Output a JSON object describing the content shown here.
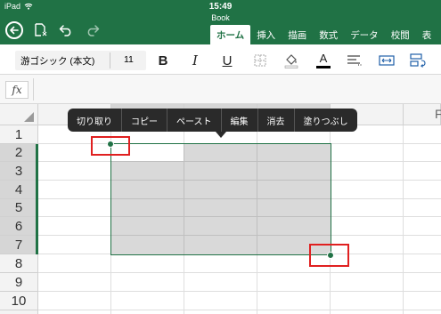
{
  "status": {
    "device": "iPad",
    "time": "15:49"
  },
  "document": {
    "title": "Book"
  },
  "tabs": [
    {
      "label": "ホーム",
      "active": true
    },
    {
      "label": "挿入"
    },
    {
      "label": "描画"
    },
    {
      "label": "数式"
    },
    {
      "label": "データ"
    },
    {
      "label": "校閲"
    },
    {
      "label": "表"
    }
  ],
  "ribbon": {
    "font_name": "游ゴシック (本文)",
    "font_size": "11",
    "bold": "B",
    "italic": "I",
    "underline": "U",
    "font_color_letter": "A",
    "font_color": "#000000"
  },
  "formula_bar": {
    "fx_label": "fx",
    "value": ""
  },
  "grid": {
    "column_header_partial": "F",
    "rows": [
      "1",
      "2",
      "3",
      "4",
      "5",
      "6",
      "7",
      "8",
      "9",
      "10"
    ],
    "selected_rows": [
      "2",
      "3",
      "4",
      "5",
      "6",
      "7"
    ]
  },
  "context_menu": {
    "items": [
      "切り取り",
      "コピー",
      "ペースト",
      "編集",
      "消去",
      "塗りつぶし"
    ]
  },
  "colors": {
    "accent": "#207245",
    "selection_fill": "#d9d9d9",
    "highlight_box": "#e02020",
    "menu_bg": "#2a2a2a"
  }
}
